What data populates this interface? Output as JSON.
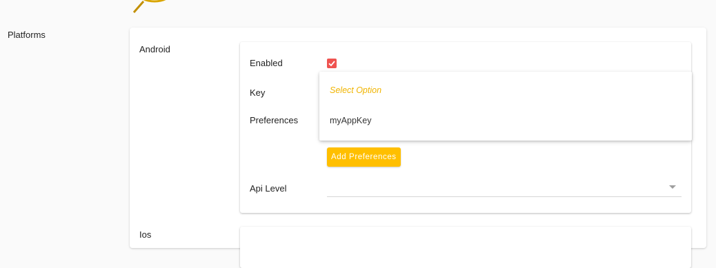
{
  "sections": {
    "platforms_label": "Platforms",
    "android_label": "Android",
    "ios_label": "Ios"
  },
  "android": {
    "enabled_label": "Enabled",
    "enabled_checked": true,
    "key_label": "Key",
    "preferences_label": "Preferences",
    "key_dropdown": {
      "placeholder": "Select Option",
      "options": [
        "myAppKey"
      ]
    },
    "add_preferences_label": "Add Preferences",
    "api_level_label": "Api Level",
    "api_level_value": ""
  },
  "colors": {
    "accent": "#ffbf00",
    "checkbox": "#ef5350",
    "placeholder": "#f0b400"
  }
}
